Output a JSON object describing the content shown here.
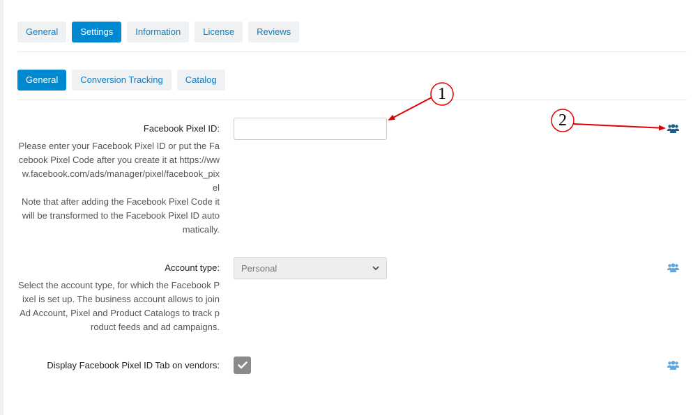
{
  "main_tabs": [
    "General",
    "Settings",
    "Information",
    "License",
    "Reviews"
  ],
  "main_tab_active": "Settings",
  "sub_tabs": [
    "General",
    "Conversion Tracking",
    "Catalog"
  ],
  "sub_tab_active": "General",
  "fields": {
    "pixel_id": {
      "label": "Facebook Pixel ID:",
      "value": "",
      "help_line1": "Please enter your Facebook Pixel ID or put the Facebook Pixel Code after you create it at https://www.facebook.com/ads/manager/pixel/facebook_pixel",
      "help_line2": "Note that after adding the Facebook Pixel Code it will be transformed to the Facebook Pixel ID automatically."
    },
    "account_type": {
      "label": "Account type:",
      "selected": "Personal",
      "help": "Select the account type, for which the Facebook Pixel is set up. The business account allows to join Ad Account, Pixel and Product Catalogs to track product feeds and ad campaigns."
    },
    "display_tab": {
      "label": "Display Facebook Pixel ID Tab on vendors:",
      "checked": true
    }
  },
  "annotations": {
    "marker1": "1",
    "marker2": "2"
  },
  "colors": {
    "accent": "#0088d1",
    "tab_text": "#0b7fc7",
    "icon_active": "#1d5f8c",
    "icon_muted": "#5aa9e6",
    "annotation_red": "#e00000"
  },
  "icons": {
    "share": "users-icon",
    "check": "check-icon",
    "dropdown": "chevron-down-icon"
  }
}
